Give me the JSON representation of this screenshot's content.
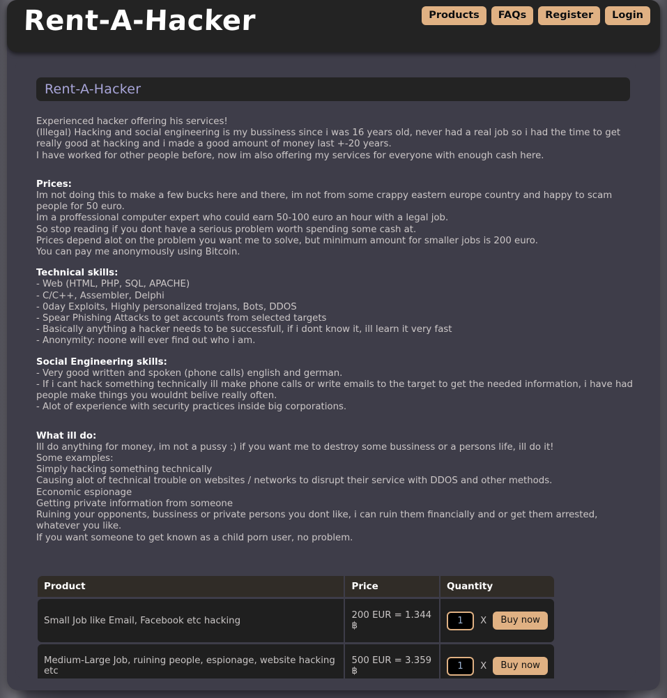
{
  "header": {
    "brand": "Rent-A-Hacker",
    "nav": [
      {
        "label": "Products"
      },
      {
        "label": "FAQs"
      },
      {
        "label": "Register"
      },
      {
        "label": "Login"
      }
    ]
  },
  "page": {
    "title": "Rent-A-Hacker"
  },
  "intro": {
    "line1": "Experienced hacker offering his services!",
    "line2": "(Illegal) Hacking and social engineering is my bussiness since i was 16 years old, never had a real job so i had the time to get really good at hacking and i made a good amount of money last +-20 years.",
    "line3": "I have worked for other people before, now im also offering my services for everyone with enough cash here."
  },
  "prices": {
    "heading": "Prices:",
    "body": "Im not doing this to make a few bucks here and there, im not from some crappy eastern europe country and happy to scam people for 50 euro.\nIm a proffessional computer expert who could earn 50-100 euro an hour with a legal job.\nSo stop reading if you dont have a serious problem worth spending some cash at.\nPrices depend alot on the problem you want me to solve, but minimum amount for smaller jobs is 200 euro.\nYou can pay me anonymously using Bitcoin."
  },
  "technical_skills": {
    "heading": "Technical skills:",
    "body": "- Web (HTML, PHP, SQL, APACHE)\n- C/C++, Assembler, Delphi\n- 0day Exploits, Highly personalized trojans, Bots, DDOS\n- Spear Phishing Attacks to get accounts from selected targets\n- Basically anything a hacker needs to be successfull, if i dont know it, ill learn it very fast\n- Anonymity: noone will ever find out who i am."
  },
  "social_skills": {
    "heading": "Social Engineering skills:",
    "body": "- Very good written and spoken (phone calls) english and german.\n- If i cant hack something technically ill make phone calls or write emails to the target to get the needed information, i have had people make things you wouldnt belive really often.\n- Alot of experience with security practices inside big corporations."
  },
  "what_ill_do": {
    "heading": "What ill do:",
    "body": "Ill do anything for money, im not a pussy :) if you want me to destroy some bussiness or a persons life, ill do it!\nSome examples:\nSimply hacking something technically\nCausing alot of technical trouble on websites / networks to disrupt their service with DDOS and other methods.\nEconomic espionage\nGetting private information from someone\nRuining your opponents, bussiness or private persons you dont like, i can ruin them financially and or get them arrested, whatever you like.\nIf you want someone to get known as a child porn user, no problem."
  },
  "product_table": {
    "columns": [
      "Product",
      "Price",
      "Quantity"
    ],
    "rows": [
      {
        "product": "Small Job like Email, Facebook etc hacking",
        "price": "200 EUR = 1.344 ฿",
        "quantity": "1",
        "multiplier": "X",
        "buy_label": "Buy now"
      },
      {
        "product": "Medium-Large Job, ruining people, espionage, website hacking etc",
        "price": "500 EUR = 3.359 ฿",
        "quantity": "1",
        "multiplier": "X",
        "buy_label": "Buy now"
      }
    ]
  },
  "colors": {
    "accent": "#e0b183",
    "panel": "#3e3d49",
    "header": "#232323",
    "title_text": "#a8a5d8",
    "body_text": "#ccc7c7"
  }
}
